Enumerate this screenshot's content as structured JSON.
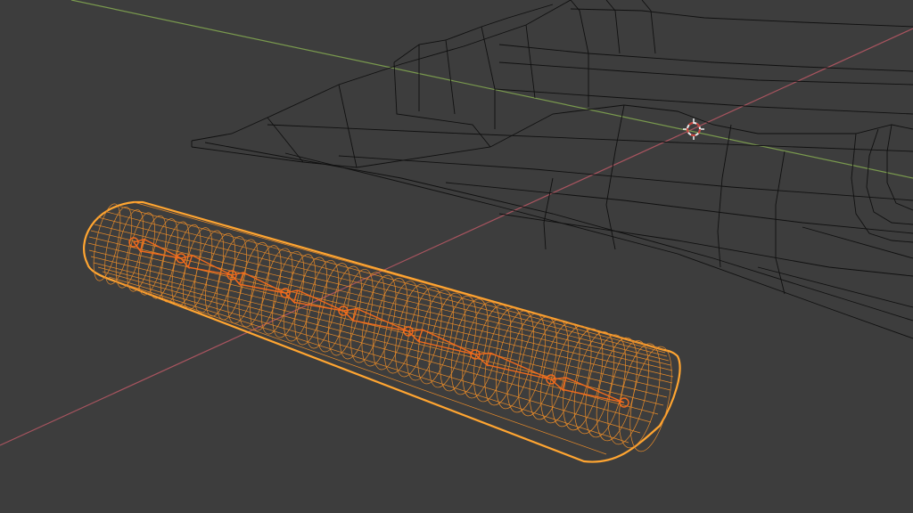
{
  "viewport": {
    "mode": "wireframe",
    "colors": {
      "background": "#3d3d3d",
      "x_axis": "#a8545f",
      "y_axis": "#7a9a4e",
      "unselected_wire": "#101010",
      "selected_mesh_outline": "#ffa531",
      "selected_mesh_wire": "#e58a2a",
      "armature_bones": "#f06a1c",
      "cursor_ring_light": "#f0f0f0",
      "cursor_ring_dark": "#c8403a"
    },
    "objects": [
      {
        "name": "wing-mesh",
        "type": "mesh",
        "selected": false
      },
      {
        "name": "cylinder-mesh",
        "type": "mesh",
        "selected": true
      },
      {
        "name": "bone-chain",
        "type": "armature",
        "selected": true,
        "bone_count": 9
      }
    ],
    "cursor_icon": "3d-cursor-icon"
  }
}
